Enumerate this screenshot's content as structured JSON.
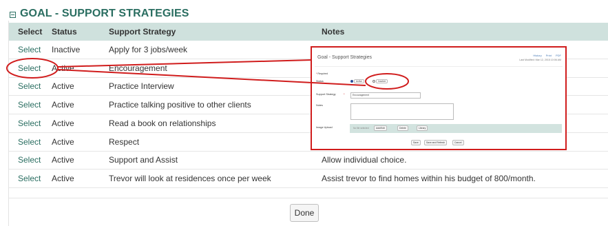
{
  "section": {
    "title": "GOAL - SUPPORT STRATEGIES"
  },
  "table": {
    "headers": {
      "select": "Select",
      "status": "Status",
      "strategy": "Support Strategy",
      "notes": "Notes"
    },
    "rows": [
      {
        "select": "Select",
        "status": "Inactive",
        "strategy": "Apply for 3 jobs/week",
        "notes": ""
      },
      {
        "select": "Select",
        "status": "Active",
        "strategy": "Encouragement",
        "notes": ""
      },
      {
        "select": "Select",
        "status": "Active",
        "strategy": "Practice Interview",
        "notes": ""
      },
      {
        "select": "Select",
        "status": "Active",
        "strategy": "Practice talking positive to other clients",
        "notes": ""
      },
      {
        "select": "Select",
        "status": "Active",
        "strategy": "Read a book on relationships",
        "notes": ""
      },
      {
        "select": "Select",
        "status": "Active",
        "strategy": "Respect",
        "notes": ""
      },
      {
        "select": "Select",
        "status": "Active",
        "strategy": "Support and Assist",
        "notes": "Allow individual choice."
      },
      {
        "select": "Select",
        "status": "Active",
        "strategy": "Trevor will look at residences once per week",
        "notes": "Assist trevor to find homes within his budget of 800/month."
      }
    ]
  },
  "done_label": "Done",
  "dialog": {
    "title": "Goal - Support Strategies",
    "toolbar": {
      "history": "History",
      "print": "Print",
      "pdf": "PDF"
    },
    "last_modified": "Last Modified: Mar 12, 2015 10:06 AM",
    "required_label": "Required",
    "status_label": "Status",
    "status_active": "Active",
    "status_inactive": "Inactive",
    "strategy_label": "Support Strategy",
    "strategy_value": "Encouragement",
    "notes_label": "Notes",
    "upload_label": "Image Upload",
    "upload_placeholder": "No file selected",
    "add_edit_button": "Add/Edit",
    "delete_button": "Delete",
    "library_button": "Library",
    "save_button": "Save",
    "save_refresh_button": "Save and Refresh",
    "cancel_button": "Cancel"
  },
  "colors": {
    "accent": "#2a6e61",
    "header_bg": "#cfe1dd",
    "annotation_red": "#d01c1c"
  }
}
